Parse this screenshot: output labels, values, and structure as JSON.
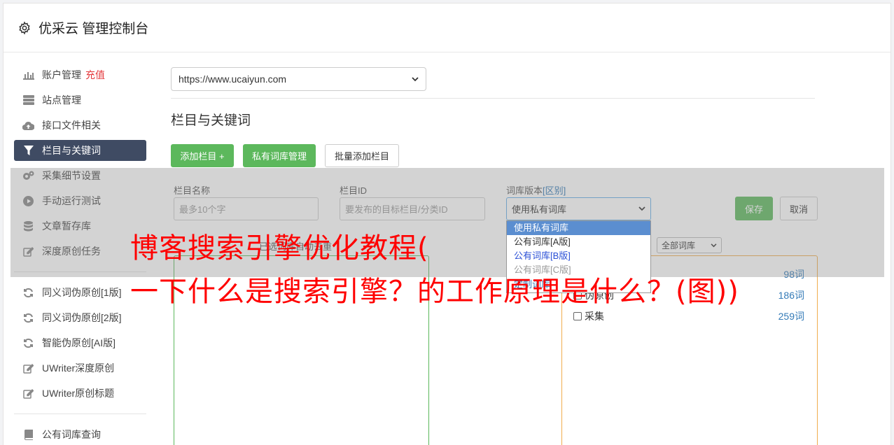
{
  "header": {
    "title": "优采云 管理控制台"
  },
  "sidebar": {
    "group1": [
      {
        "label": "账户管理",
        "icon": "bar-chart-icon",
        "extra": "充值"
      },
      {
        "label": "站点管理",
        "icon": "server-icon"
      },
      {
        "label": "接口文件相关",
        "icon": "cloud-upload-icon"
      },
      {
        "label": "栏目与关键词",
        "icon": "filter-icon",
        "active": true
      },
      {
        "label": "采集细节设置",
        "icon": "cogs-icon"
      },
      {
        "label": "手动运行测试",
        "icon": "play-circle-icon"
      },
      {
        "label": "文章暂存库",
        "icon": "database-icon"
      },
      {
        "label": "深度原创任务",
        "icon": "edit-icon"
      }
    ],
    "group2": [
      {
        "label": "同义词伪原创[1版]",
        "icon": "refresh-icon"
      },
      {
        "label": "同义词伪原创[2版]",
        "icon": "refresh-icon"
      },
      {
        "label": "智能伪原创[AI版]",
        "icon": "refresh-icon"
      },
      {
        "label": "UWriter深度原创",
        "icon": "edit-icon"
      },
      {
        "label": "UWriter原创标题",
        "icon": "edit-icon"
      }
    ],
    "group3": [
      {
        "label": "公有词库查询",
        "icon": "book-icon"
      }
    ]
  },
  "main": {
    "site_select": "https://www.ucaiyun.com",
    "section_title": "栏目与关键词",
    "buttons": {
      "add_column": "添加栏目 +",
      "private_lib": "私有词库管理",
      "batch_add": "批量添加栏目"
    },
    "form": {
      "name_label": "栏目名称",
      "name_placeholder": "最多10个字",
      "id_label": "栏目ID",
      "id_placeholder": "要发布的目标栏目/分类ID",
      "lib_label": "词库版本",
      "lib_link": "[区别]",
      "lib_value": "使用私有词库",
      "save": "保存",
      "cancel": "取消"
    },
    "dropdown": {
      "options": [
        "使用私有词库",
        "公有词库[A版]",
        "公有词库[B版]",
        "公有词库[C版]"
      ],
      "link": "定制词库"
    },
    "filter": {
      "hint": "已选词库自动去重",
      "lib_filter": "全部词库"
    },
    "keywords": [
      {
        "label": "",
        "count": "98词"
      },
      {
        "label": "伪原创",
        "count": "186词"
      },
      {
        "label": "采集",
        "count": "259词"
      }
    ]
  },
  "watermark": {
    "line1": "博客搜索引擎优化教程(",
    "line2": "一下什么是搜索引擎？的工作原理是什么？(图))"
  }
}
